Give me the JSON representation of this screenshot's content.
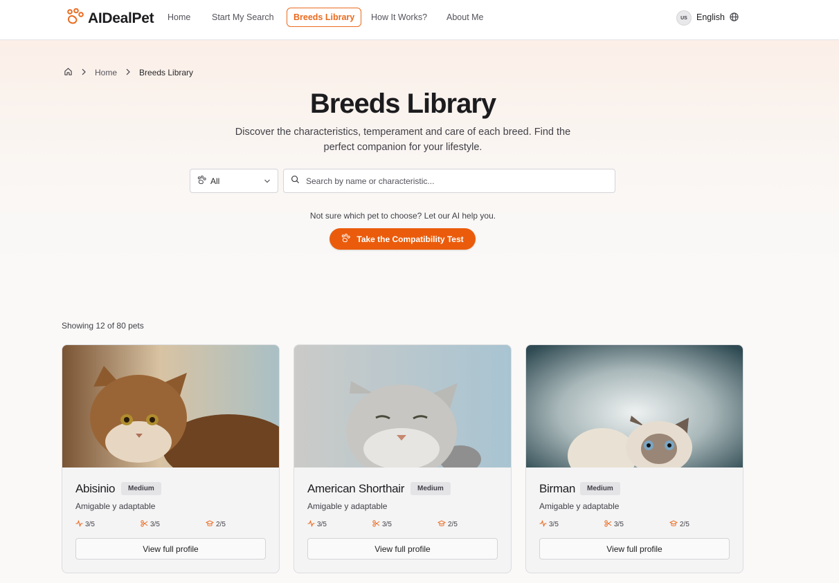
{
  "header": {
    "brand": "AIDealPet",
    "nav": [
      "Home",
      "Start My Search",
      "Breeds Library",
      "How It Works?",
      "About Me"
    ],
    "active_nav": "Breeds Library",
    "language_code": "US",
    "language_label": "English",
    "accent_color": "#ea6a1e"
  },
  "breadcrumb": {
    "home_icon": "home-icon",
    "items": [
      "Home",
      "Breeds Library"
    ]
  },
  "hero": {
    "title": "Breeds Library",
    "subtitle": "Discover the characteristics, temperament and care of each breed. Find the perfect companion for your lifestyle."
  },
  "filters": {
    "type_select_value": "All",
    "search_placeholder": "Search by name or characteristic..."
  },
  "ai_prompt": {
    "text": "Not sure which pet to choose? Let our AI help you.",
    "button_label": "Take the Compatibility Test",
    "button_color": "#ea5c0c"
  },
  "results": {
    "count_text": "Showing 12 of 80 pets"
  },
  "cards": [
    {
      "name": "Abisinio",
      "size": "Medium",
      "description": "Amigable y adaptable",
      "energy": "3/5",
      "grooming": "3/5",
      "training": "2/5",
      "button_label": "View full profile"
    },
    {
      "name": "American Shorthair",
      "size": "Medium",
      "description": "Amigable y adaptable",
      "energy": "3/5",
      "grooming": "3/5",
      "training": "2/5",
      "button_label": "View full profile"
    },
    {
      "name": "Birman",
      "size": "Medium",
      "description": "Amigable y adaptable",
      "energy": "3/5",
      "grooming": "3/5",
      "training": "2/5",
      "button_label": "View full profile"
    }
  ]
}
